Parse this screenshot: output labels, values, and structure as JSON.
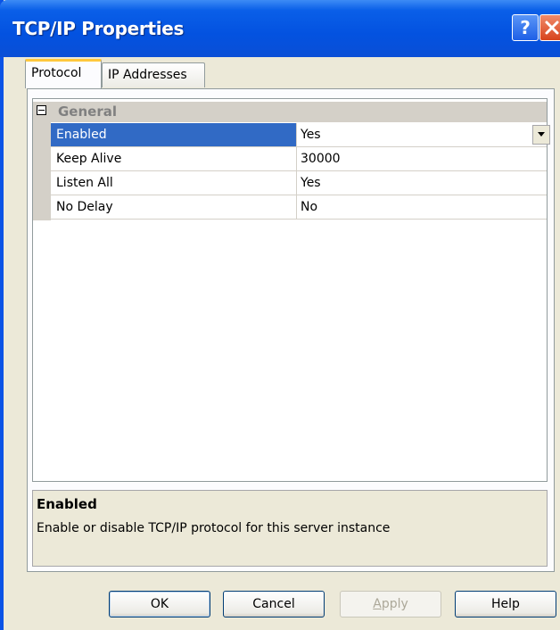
{
  "window": {
    "title": "TCP/IP Properties",
    "help_icon": "question-mark-icon",
    "close_icon": "close-icon",
    "colors": {
      "titlebar": "#0352e0",
      "selection": "#316ac5",
      "close": "#d7431c"
    }
  },
  "tabs": [
    {
      "label": "Protocol",
      "active": true
    },
    {
      "label": "IP Addresses",
      "active": false
    }
  ],
  "grid": {
    "category": "General",
    "properties": [
      {
        "name": "Enabled",
        "value": "Yes",
        "selected": true
      },
      {
        "name": "Keep Alive",
        "value": "30000"
      },
      {
        "name": "Listen All",
        "value": "Yes"
      },
      {
        "name": "No Delay",
        "value": "No"
      }
    ]
  },
  "description": {
    "title": "Enabled",
    "text": "Enable or disable TCP/IP protocol for this server instance"
  },
  "buttons": {
    "ok": "OK",
    "cancel": "Cancel",
    "apply_first": "A",
    "apply_rest": "pply",
    "help": "Help"
  }
}
